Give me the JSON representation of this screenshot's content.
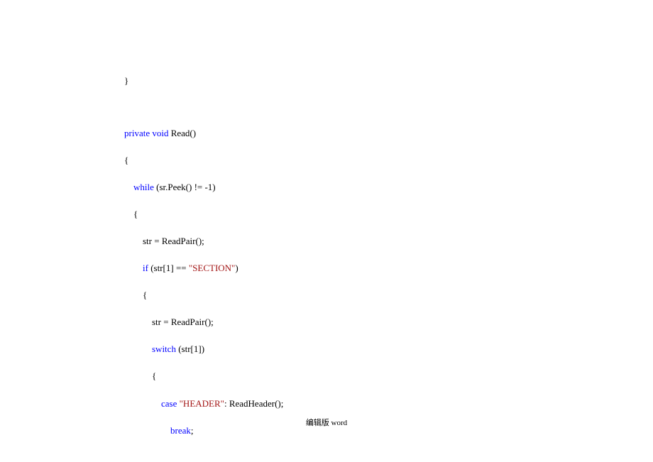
{
  "code": {
    "l1": "        }",
    "l2_a": "        ",
    "l2_kw1": "private",
    "l2_b": " ",
    "l2_kw2": "void",
    "l2_c": " Read()",
    "l3": "        {",
    "l4_a": "            ",
    "l4_kw": "while",
    "l4_b": " (sr.Peek() != -1)",
    "l5": "            {",
    "l6": "                str = ReadPair();",
    "l7_a": "                ",
    "l7_kw": "if",
    "l7_b": " (str[1] == ",
    "l7_str": "\"SECTION\"",
    "l7_c": ")",
    "l8": "                {",
    "l9": "                    str = ReadPair();",
    "l10_a": "                    ",
    "l10_kw": "switch",
    "l10_b": " (str[1])",
    "l11": "                    {",
    "l12_a": "                        ",
    "l12_kw": "case",
    "l12_b": " ",
    "l12_str": "\"HEADER\"",
    "l12_c": ": ReadHeader();",
    "l13_a": "                            ",
    "l13_kw": "break",
    "l13_b": ";"
  },
  "footer": "编辑版 word"
}
